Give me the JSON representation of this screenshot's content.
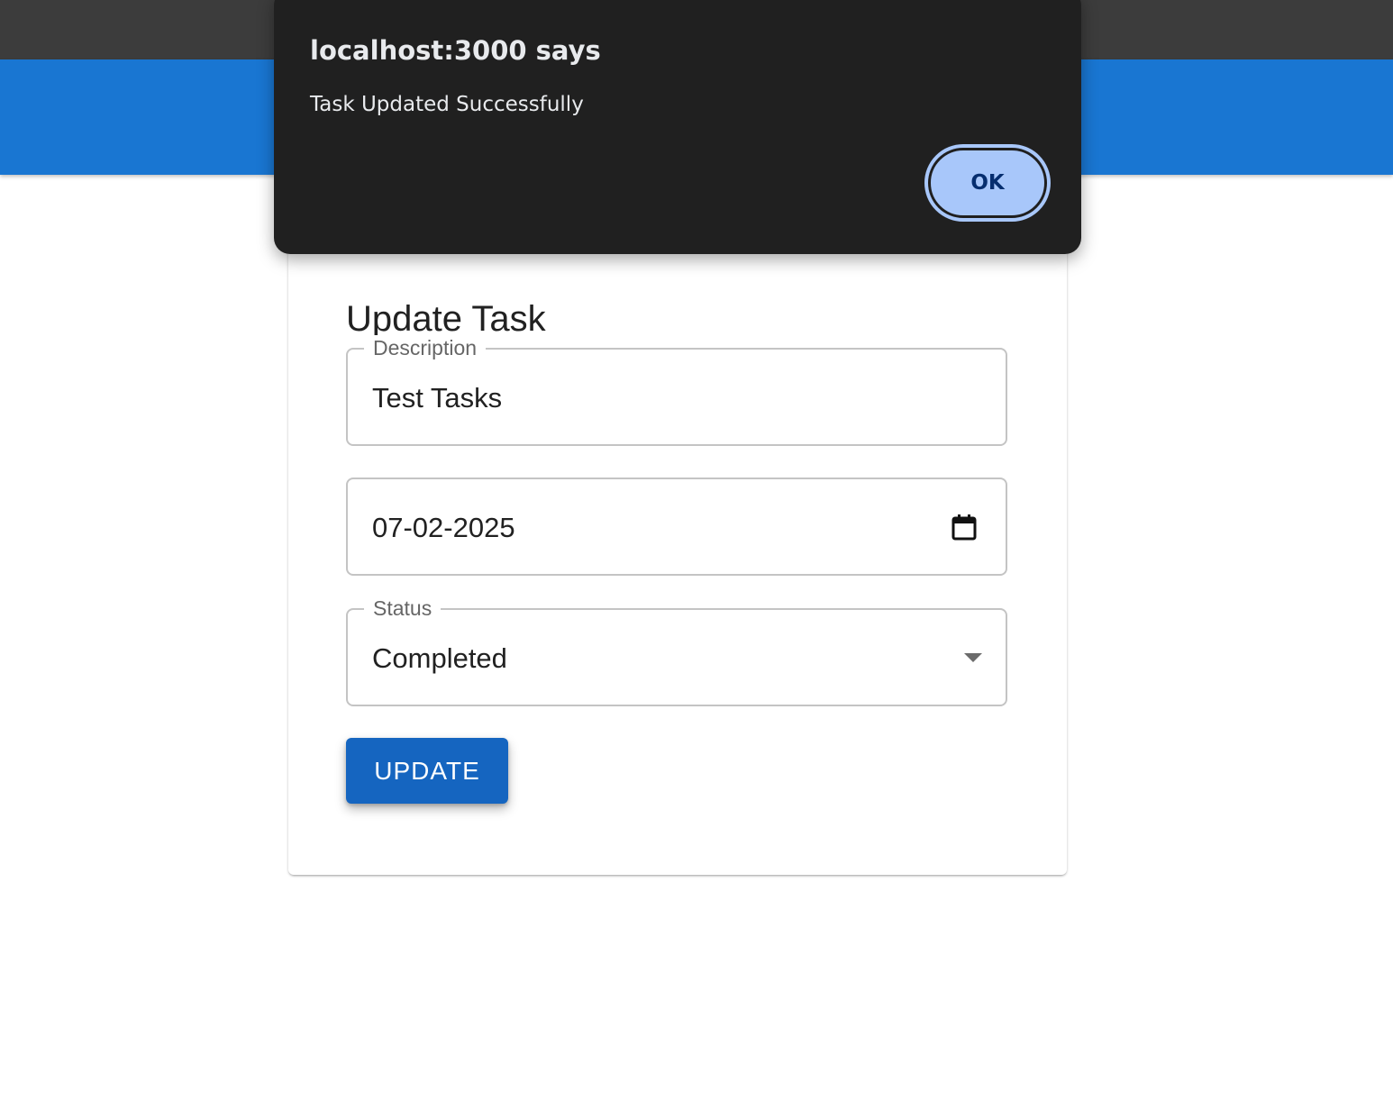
{
  "alert": {
    "title": "localhost:3000 says",
    "message": "Task Updated Successfully",
    "ok_label": "OK"
  },
  "form": {
    "title": "Update Task",
    "description": {
      "label": "Description",
      "value": "Test Tasks"
    },
    "date": {
      "value": "07-02-2025"
    },
    "status": {
      "label": "Status",
      "value": "Completed"
    },
    "update_label": "UPDATE"
  },
  "colors": {
    "app_bar": "#1976d2",
    "update_button": "#1565c0",
    "dialog_background": "#202020",
    "ok_button": "#a8c7fa"
  }
}
